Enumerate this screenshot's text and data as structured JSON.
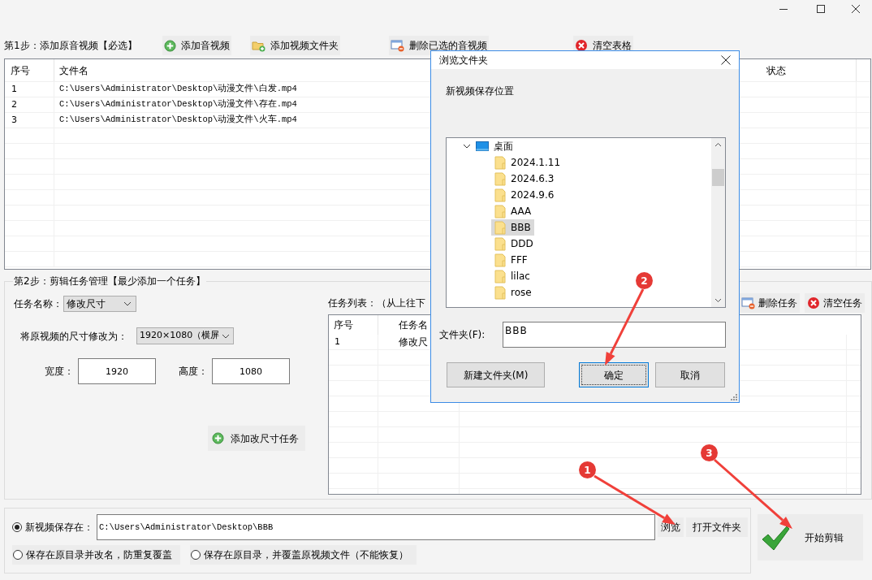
{
  "step1": {
    "label": "第1步：添加原音视频【必选】",
    "buttons": [
      {
        "label": "添加音视频",
        "kind": "add"
      },
      {
        "label": "添加视频文件夹",
        "kind": "folder-add"
      },
      {
        "label": "删除已选的音视频",
        "kind": "remove"
      },
      {
        "label": "清空表格",
        "kind": "clear"
      }
    ]
  },
  "file_table": {
    "columns": [
      "序号",
      "文件名",
      "状态"
    ],
    "rows": [
      {
        "index": "1",
        "file": "C:\\Users\\Administrator\\Desktop\\动漫文件\\白发.mp4"
      },
      {
        "index": "2",
        "file": "C:\\Users\\Administrator\\Desktop\\动漫文件\\存在.mp4"
      },
      {
        "index": "3",
        "file": "C:\\Users\\Administrator\\Desktop\\动漫文件\\火车.mp4"
      }
    ]
  },
  "step2": {
    "title": "第2步：剪辑任务管理【最少添加一个任务】",
    "task_name_label": "任务名称：",
    "task_name_value": "修改尺寸",
    "size_label": "将原视频的尺寸修改为：",
    "size_value": "1920×1080（横屏",
    "width_label": "宽度：",
    "width_value": "1920",
    "height_label": "高度：",
    "height_value": "1080",
    "add_button": "添加改尺寸任务",
    "task_list_label": "任务列表：（从上往下",
    "task_buttons": [
      {
        "label": "删除任务",
        "kind": "remove"
      },
      {
        "label": "清空任务",
        "kind": "clear"
      }
    ],
    "task_table": {
      "columns": [
        "序号",
        "任务名"
      ],
      "rows": [
        {
          "index": "1",
          "task": "修改尺"
        }
      ]
    }
  },
  "output": {
    "options": [
      {
        "label": "新视频保存在：",
        "selected": true
      },
      {
        "label": "保存在原目录并改名，防重复覆盖",
        "selected": false
      },
      {
        "label": "保存在原目录，并覆盖原视频文件（不能恢复）",
        "selected": false
      }
    ],
    "path": "C:\\Users\\Administrator\\Desktop\\BBB",
    "browse_button": "浏览",
    "open_folder_button": "打开文件夹"
  },
  "start_button": "开始剪辑",
  "dialog": {
    "title": "浏览文件夹",
    "description": "新视频保存位置",
    "tree": [
      {
        "label": "桌面",
        "expanded": true,
        "children": [
          {
            "label": "2024.1.11",
            "selected": false
          },
          {
            "label": "2024.6.3",
            "selected": false
          },
          {
            "label": "2024.9.6",
            "selected": false
          },
          {
            "label": "AAA",
            "selected": false
          },
          {
            "label": "BBB",
            "selected": true
          },
          {
            "label": "DDD",
            "selected": false
          },
          {
            "label": "FFF",
            "selected": false
          },
          {
            "label": "lilac",
            "selected": false
          },
          {
            "label": "rose",
            "selected": false
          }
        ]
      }
    ],
    "folder_label": "文件夹(F):",
    "folder_value": "BBB",
    "buttons": [
      {
        "label": "新建文件夹(M)",
        "focused": false
      },
      {
        "label": "确定",
        "focused": true
      },
      {
        "label": "取消",
        "focused": false
      }
    ]
  },
  "annotations": [
    {
      "number": "1"
    },
    {
      "number": "2"
    },
    {
      "number": "3"
    }
  ]
}
